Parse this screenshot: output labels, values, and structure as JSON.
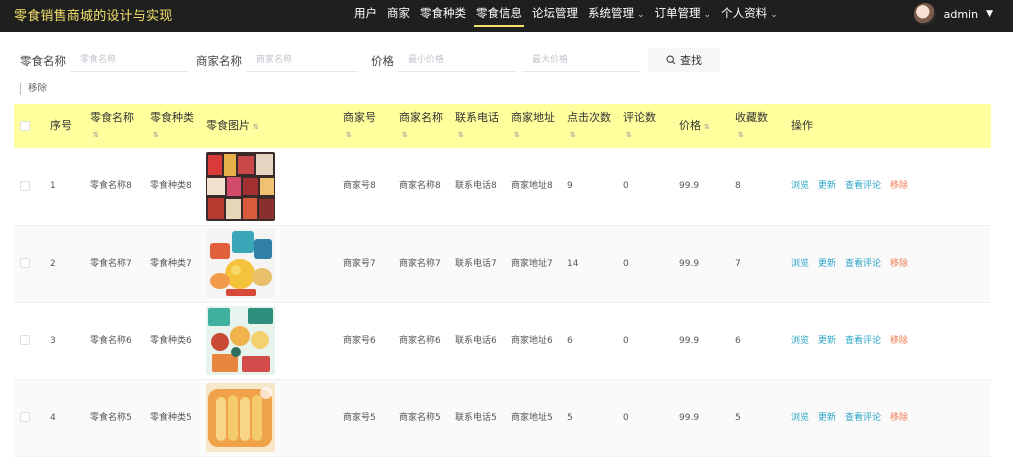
{
  "app_title": "零食销售商城的设计与实现",
  "nav": [
    {
      "label": "用户",
      "dropdown": false,
      "active": false
    },
    {
      "label": "商家",
      "dropdown": false,
      "active": false
    },
    {
      "label": "零食种类",
      "dropdown": false,
      "active": false
    },
    {
      "label": "零食信息",
      "dropdown": false,
      "active": true
    },
    {
      "label": "论坛管理",
      "dropdown": false,
      "active": false
    },
    {
      "label": "系统管理",
      "dropdown": true,
      "active": false
    },
    {
      "label": "订单管理",
      "dropdown": true,
      "active": false
    },
    {
      "label": "个人资料",
      "dropdown": true,
      "active": false
    }
  ],
  "user": {
    "name": "admin"
  },
  "search": {
    "name_label": "零食名称",
    "name_placeholder": "零食名称",
    "merchant_label": "商家名称",
    "merchant_placeholder": "商家名称",
    "price_label": "价格",
    "min_price_placeholder": "最小价格",
    "max_price_placeholder": "最大价格",
    "search_button": "查找"
  },
  "toolbar": {
    "remove_label": "移除"
  },
  "table": {
    "headers": {
      "index": "序号",
      "name": "零食名称",
      "category": "零食种类",
      "image": "零食图片",
      "merchant_no": "商家号",
      "merchant_name": "商家名称",
      "phone": "联系电话",
      "address": "商家地址",
      "clicks": "点击次数",
      "comments": "评论数",
      "price": "价格",
      "favorites": "收藏数",
      "actions": "操作"
    },
    "actions": {
      "view": "浏览",
      "update": "更新",
      "comments": "查看评论",
      "delete": "移除"
    },
    "rows": [
      {
        "index": "1",
        "name": "零食名称8",
        "category": "零食种类8",
        "merchant_no": "商家号8",
        "merchant_name": "商家名称8",
        "phone": "联系电话8",
        "address": "商家地址8",
        "clicks": "9",
        "comments": "0",
        "price": "99.9",
        "favorites": "8"
      },
      {
        "index": "2",
        "name": "零食名称7",
        "category": "零食种类7",
        "merchant_no": "商家号7",
        "merchant_name": "商家名称7",
        "phone": "联系电话7",
        "address": "商家地址7",
        "clicks": "14",
        "comments": "0",
        "price": "99.9",
        "favorites": "7"
      },
      {
        "index": "3",
        "name": "零食名称6",
        "category": "零食种类6",
        "merchant_no": "商家号6",
        "merchant_name": "商家名称6",
        "phone": "联系电话6",
        "address": "商家地址6",
        "clicks": "6",
        "comments": "0",
        "price": "99.9",
        "favorites": "6"
      },
      {
        "index": "4",
        "name": "零食名称5",
        "category": "零食种类5",
        "merchant_no": "商家号5",
        "merchant_name": "商家名称5",
        "phone": "联系电话5",
        "address": "商家地址5",
        "clicks": "5",
        "comments": "0",
        "price": "99.9",
        "favorites": "5"
      }
    ]
  },
  "colors": {
    "topbar": "#1f1f1f",
    "title": "#f2e06a",
    "header_row": "#ffff9e",
    "link": "#2aa5c7",
    "danger": "#f07b4f"
  }
}
